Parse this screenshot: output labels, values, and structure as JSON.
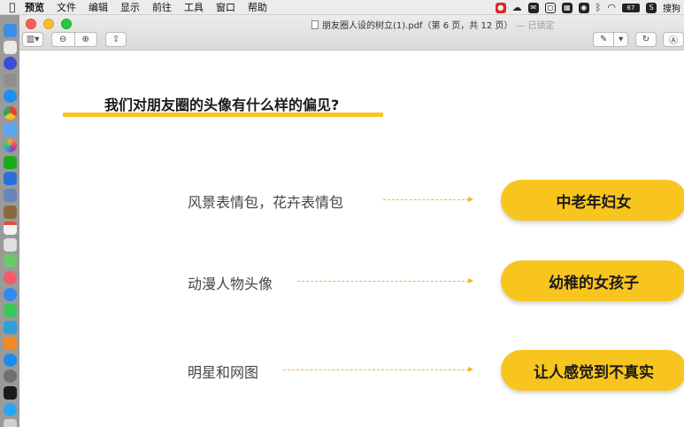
{
  "menubar": {
    "app_name": "预览",
    "menus": [
      "文件",
      "编辑",
      "显示",
      "前往",
      "工具",
      "窗口",
      "帮助"
    ],
    "tray": {
      "battery_label": "67",
      "input_method_label": "搜狗",
      "status_icons": [
        "cloud-icon",
        "chat-icon",
        "app-icon",
        "app-icon",
        "app-icon",
        "bluetooth-icon",
        "wifi-icon"
      ]
    }
  },
  "window": {
    "title": "朋友圈人设的树立(1).pdf（第 6 页，共 12 页）",
    "title_suffix": "— 已锁定",
    "toolbar_icons": [
      "sidebar-icon",
      "zoom-out-icon",
      "zoom-in-icon",
      "share-icon",
      "markup-icon",
      "rotate-icon",
      "annotate-icon"
    ]
  },
  "slide": {
    "heading": "我们对朋友圈的头像有什么样的偏见?",
    "accent_color": "#f7c51e",
    "rows": [
      {
        "label": "风景表情包，花卉表情包",
        "result": "中老年妇女"
      },
      {
        "label": "动漫人物头像",
        "result": "幼稚的女孩子"
      },
      {
        "label": "明星和网图",
        "result": "让人感觉到不真实"
      }
    ]
  }
}
